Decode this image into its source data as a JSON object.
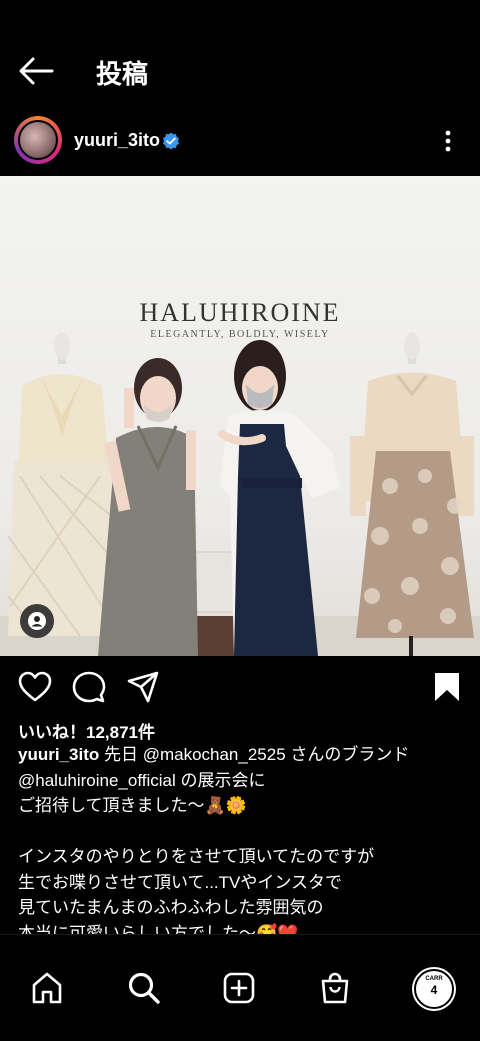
{
  "header": {
    "title": "投稿"
  },
  "post": {
    "username": "yuuri_3ito",
    "photo": {
      "brand": "HALUHIROINE",
      "brand_tagline": "ELEGANTLY, BOLDLY, WISELY"
    },
    "likes": "いいね！12,871件",
    "caption_user": "yuuri_3ito",
    "caption_lines": [
      " 先日 @makochan_2525 さんのブランド",
      "@haluhiroine_official の展示会に",
      "ご招待して頂きました〜🧸🌼",
      "",
      "インスタのやりとりをさせて頂いてたのですが",
      "生でお喋りさせて頂いて...TVやインスタで",
      "見ていたまんまのふわふわした雰囲気の",
      "本当に可愛いらしい方でした〜🥰❤️"
    ]
  },
  "profile_badge": {
    "top": "CARR",
    "num": "4"
  },
  "colors": {
    "verified": "#3897f0",
    "background": "#000000",
    "text": "#ffffff"
  }
}
